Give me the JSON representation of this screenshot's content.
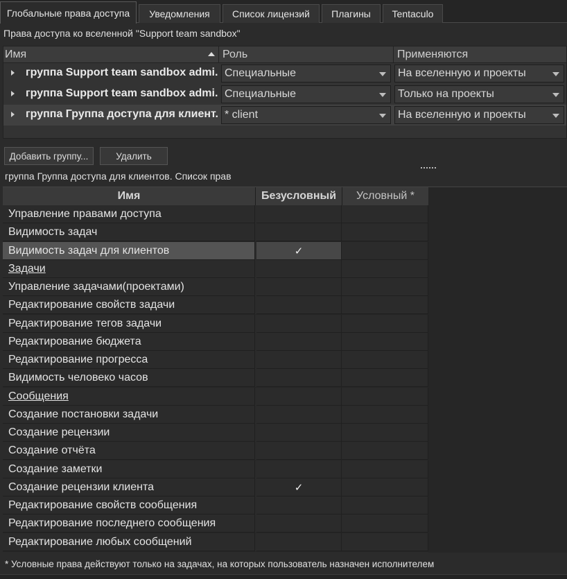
{
  "tabs": [
    {
      "label": "Глобальные права доступа",
      "active": true
    },
    {
      "label": "Уведомления"
    },
    {
      "label": "Список лицензий"
    },
    {
      "label": "Плагины"
    },
    {
      "label": "Tentaculo"
    }
  ],
  "access_title": "Права доступа ко вселенной \"Support team sandbox\"",
  "groups_table": {
    "columns": [
      "Имя",
      "Роль",
      "Применяются"
    ],
    "rows": [
      {
        "name": "группа Support team sandbox admi...",
        "role": "Специальные",
        "applies": "На вселенную и проекты"
      },
      {
        "name": "группа Support team sandbox admi...",
        "role": "Специальные",
        "applies": "Только на проекты"
      },
      {
        "name": "группа Группа доступа для клиент...",
        "role": "* client",
        "applies": "На вселенную и проекты"
      }
    ]
  },
  "buttons": {
    "add_group": "Добавить группу...",
    "delete": "Удалить"
  },
  "rights_title": "группа Группа доступа для клиентов. Список прав",
  "rights_table": {
    "columns": [
      "Имя",
      "Безусловный",
      "Условный *"
    ],
    "rows": [
      {
        "name": "Управление правами доступа",
        "unconditional": "",
        "conditional": ""
      },
      {
        "name": "Видимость задач",
        "unconditional": "",
        "conditional": ""
      },
      {
        "name": "Видимость задач для клиентов",
        "unconditional": "✓",
        "conditional": ""
      },
      {
        "name": "Задачи",
        "unconditional": "",
        "conditional": ""
      },
      {
        "name": "Управление задачами(проектами)",
        "unconditional": "",
        "conditional": ""
      },
      {
        "name": "Редактирование свойств задачи",
        "unconditional": "",
        "conditional": ""
      },
      {
        "name": "Редактирование тегов задачи",
        "unconditional": "",
        "conditional": ""
      },
      {
        "name": "Редактирование бюджета",
        "unconditional": "",
        "conditional": ""
      },
      {
        "name": "Редактирование прогресса",
        "unconditional": "",
        "conditional": ""
      },
      {
        "name": "Видимость человеко часов",
        "unconditional": "",
        "conditional": ""
      },
      {
        "name": "Сообщения",
        "unconditional": "",
        "conditional": ""
      },
      {
        "name": "Создание постановки задачи",
        "unconditional": "",
        "conditional": ""
      },
      {
        "name": "Создание рецензии",
        "unconditional": "",
        "conditional": ""
      },
      {
        "name": "Создание отчёта",
        "unconditional": "",
        "conditional": ""
      },
      {
        "name": "Создание заметки",
        "unconditional": "",
        "conditional": ""
      },
      {
        "name": "Создание рецензии клиента",
        "unconditional": "✓",
        "conditional": ""
      },
      {
        "name": "Редактирование свойств сообщения",
        "unconditional": "",
        "conditional": ""
      },
      {
        "name": "Редактирование последнего сообщения",
        "unconditional": "",
        "conditional": ""
      },
      {
        "name": "Редактирование любых сообщений",
        "unconditional": "",
        "conditional": ""
      }
    ]
  },
  "footnote": "* Условные права действуют только на задачах, на которых пользователь назначен исполнителем"
}
